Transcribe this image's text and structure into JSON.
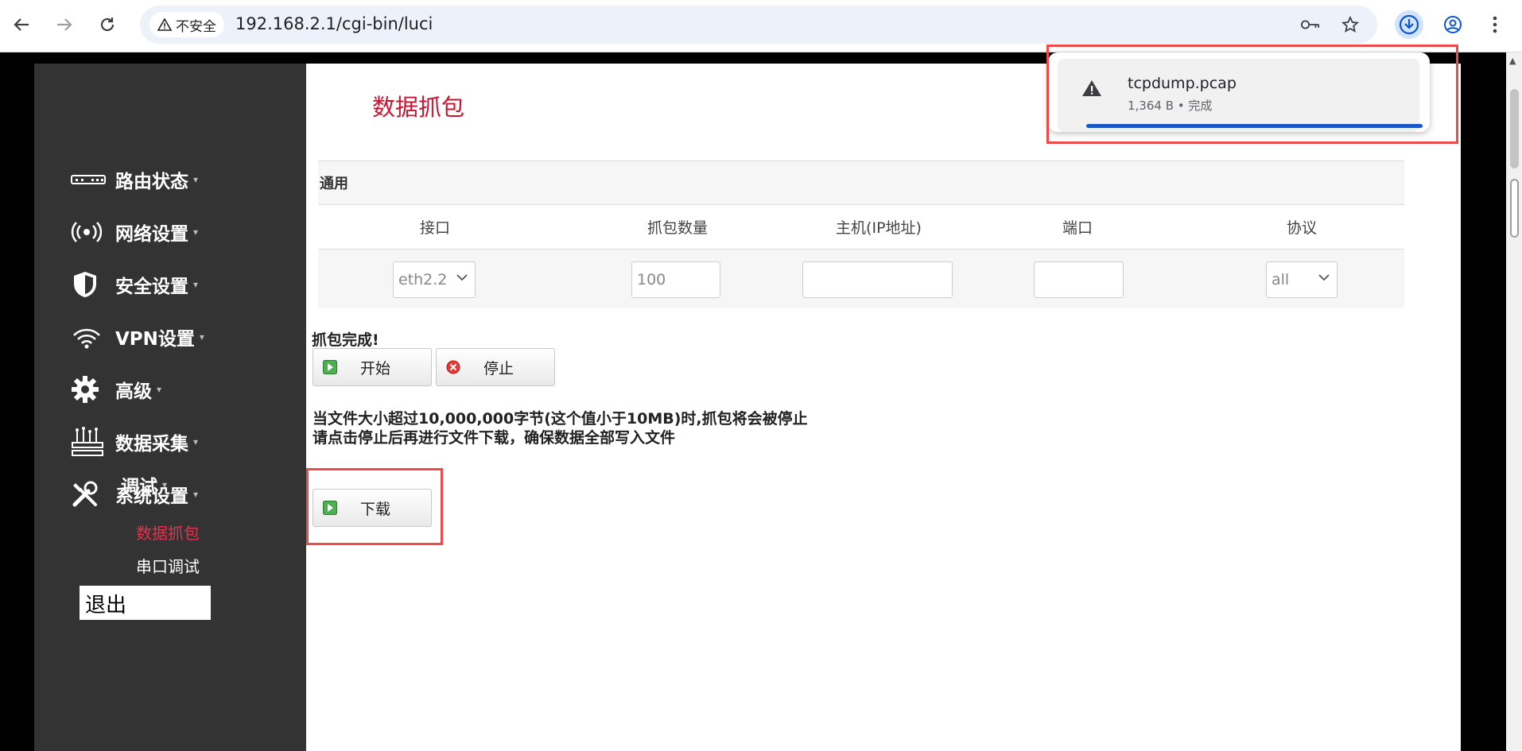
{
  "browser": {
    "security_label": "不安全",
    "url": "192.168.2.1/cgi-bin/luci",
    "download": {
      "file_name": "tcpdump.pcap",
      "meta": "1,364 B • 完成",
      "progress": 1.0
    }
  },
  "sidebar": {
    "menu": [
      {
        "label": "路由状态",
        "icon": "router-icon"
      },
      {
        "label": "网络设置",
        "icon": "antenna-icon"
      },
      {
        "label": "安全设置",
        "icon": "shield-icon"
      },
      {
        "label": "VPN设置",
        "icon": "vpn-icon"
      },
      {
        "label": "高级",
        "icon": "gear-icon"
      },
      {
        "label": "数据采集",
        "icon": "data-collect-icon"
      },
      {
        "label": "系统设置",
        "icon": "tools-icon"
      }
    ],
    "debug_label": "调试",
    "sub_items": [
      {
        "label": "数据抓包",
        "active": true
      },
      {
        "label": "串口调试",
        "active": false
      }
    ],
    "logout_label": "退出",
    "caret": "▾"
  },
  "main": {
    "title": "数据抓包",
    "section_label": "通用",
    "columns": [
      "接口",
      "抓包数量",
      "主机(IP地址)",
      "端口",
      "协议"
    ],
    "fields": {
      "interface_value": "eth2.2",
      "count_value": "100",
      "host_value": "",
      "port_value": "",
      "protocol_value": "all"
    },
    "status_text": "抓包完成!",
    "start_label": "开始",
    "stop_label": "停止",
    "note_line1": "当文件大小超过10,000,000字节(这个值小于10MB)时,抓包将会被停止",
    "note_line2": "请点击停止后再进行文件下载，确保数据全部写入文件",
    "download_label": "下载"
  },
  "colors": {
    "accent_red": "#c81431",
    "active_link": "#e8304e",
    "sidebar_bg": "#333333",
    "highlight": "#ee4a4a",
    "progress_blue": "#1a57c7"
  }
}
